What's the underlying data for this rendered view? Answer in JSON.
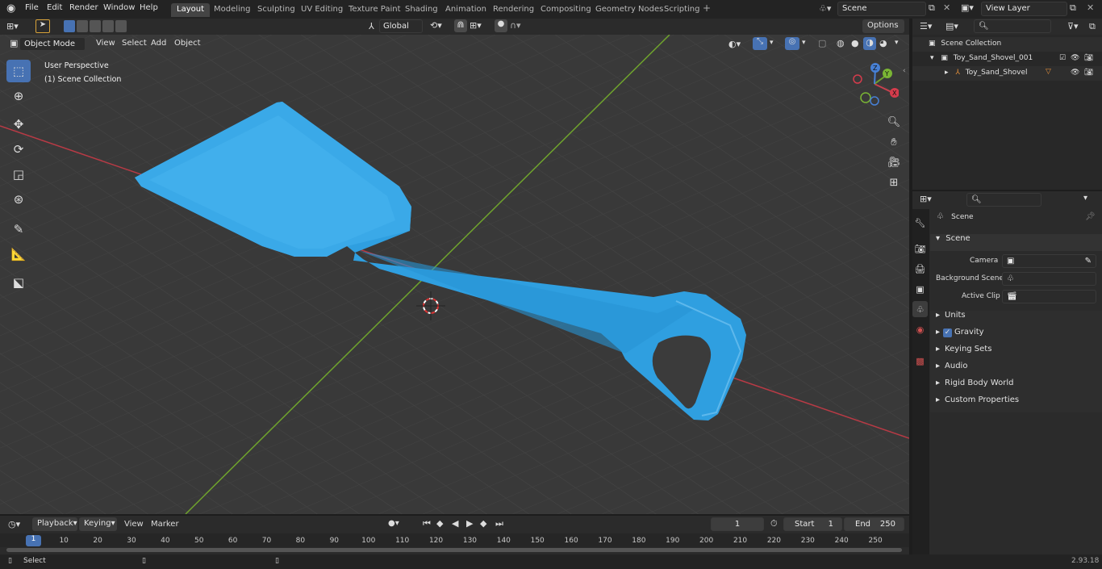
{
  "topbar": {
    "menus": [
      "File",
      "Edit",
      "Render",
      "Window",
      "Help"
    ],
    "workspaces": [
      "Layout",
      "Modeling",
      "Sculpting",
      "UV Editing",
      "Texture Paint",
      "Shading",
      "Animation",
      "Rendering",
      "Compositing",
      "Geometry Nodes",
      "Scripting"
    ],
    "add_tab": "+",
    "scene": "Scene",
    "view_layer": "View Layer"
  },
  "header": {
    "mode": "Object Mode",
    "view": "View",
    "select": "Select",
    "add": "Add",
    "object": "Object",
    "orientation": "Global",
    "options": "Options"
  },
  "viewport": {
    "perspective": "User Perspective",
    "collection": "(1) Scene Collection"
  },
  "outliner": {
    "root": "Scene Collection",
    "collection": "Toy_Sand_Shovel_001",
    "object": "Toy_Sand_Shovel"
  },
  "properties": {
    "title": "Scene",
    "section": "Scene",
    "camera_label": "Camera",
    "background_label": "Background Scene",
    "active_clip_label": "Active Clip",
    "panels": [
      "Units",
      "Gravity",
      "Keying Sets",
      "Audio",
      "Rigid Body World",
      "Custom Properties"
    ]
  },
  "timeline": {
    "playback": "Playback",
    "keying": "Keying",
    "view": "View",
    "marker": "Marker",
    "current_frame": "1",
    "start_label": "Start",
    "start": "1",
    "end_label": "End",
    "end": "250",
    "ticks": [
      "1",
      "10",
      "20",
      "30",
      "40",
      "50",
      "60",
      "70",
      "80",
      "90",
      "100",
      "110",
      "120",
      "130",
      "140",
      "150",
      "160",
      "170",
      "180",
      "190",
      "200",
      "210",
      "220",
      "230",
      "240",
      "250"
    ]
  },
  "statusbar": {
    "select": "Select",
    "version": "2.93.18"
  },
  "colors": {
    "accent": "#4772b3",
    "shovel": "#2f9fe0",
    "x_axis": "#b83a45",
    "y_axis": "#6fa32d"
  }
}
